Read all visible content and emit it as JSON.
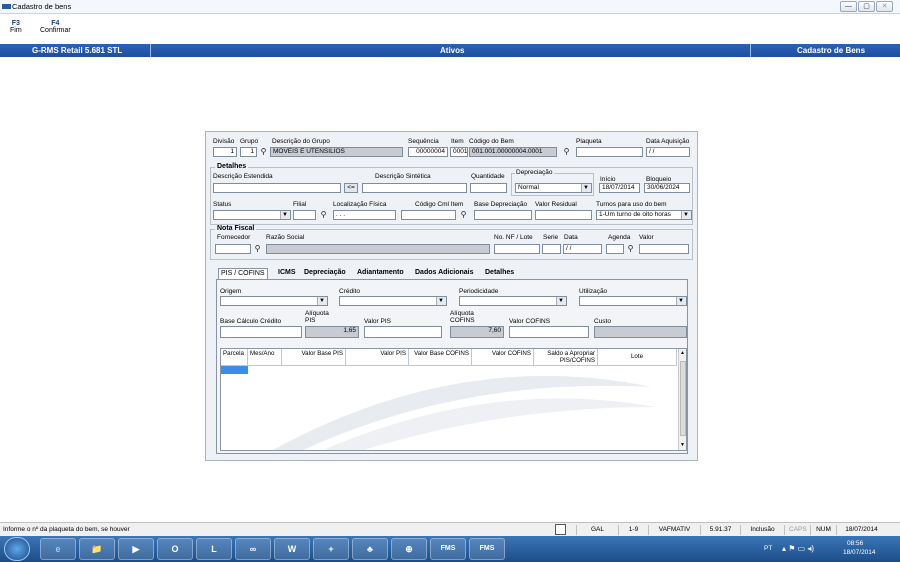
{
  "window": {
    "title": "Cadastro de bens"
  },
  "fkeys": [
    {
      "key": "F3",
      "label": "Fim"
    },
    {
      "key": "F4",
      "label": "Confirmar"
    }
  ],
  "header": {
    "left": "G-RMS Retail 5.681 STL",
    "center": "Ativos",
    "right": "Cadastro de Bens"
  },
  "form": {
    "divisao": {
      "label": "Divisão",
      "value": "1"
    },
    "grupo": {
      "label": "Grupo",
      "value": "1"
    },
    "desc_grupo": {
      "label": "Descrição do Grupo",
      "value": "MOVEIS E UTENSILIOS"
    },
    "sequencia": {
      "label": "Sequência",
      "value": "00000004"
    },
    "item": {
      "label": "Item",
      "value": "0001"
    },
    "codigo_bem": {
      "label": "Código do Bem",
      "value": "001.001.00000004.0001"
    },
    "plaqueta": {
      "label": "Plaqueta",
      "value": ""
    },
    "data_aquisicao": {
      "label": "Data Aquisição",
      "value": "/ /"
    },
    "detalhes_title": "Detalhes",
    "desc_estendida": {
      "label": "Descrição Estendida",
      "value": ""
    },
    "copy_btn": "<=",
    "desc_sintetica": {
      "label": "Descrição Sintética",
      "value": ""
    },
    "quantidade": {
      "label": "Quantidade",
      "value": ""
    },
    "depreciacao_group": "Depreciação",
    "depreciacao_sel": "Normal",
    "inicio": {
      "label": "Início",
      "value": "18/07/2014"
    },
    "bloqueio": {
      "label": "Bloqueio",
      "value": "30/06/2024"
    },
    "status": {
      "label": "Status",
      "value": ""
    },
    "filial": {
      "label": "Filial",
      "value": ""
    },
    "localizacao": {
      "label": "Localização Física",
      "value": ". . ."
    },
    "codigo_cml": {
      "label": "Código Cml Item",
      "value": ""
    },
    "base_dep": {
      "label": "Base Depreciação",
      "value": ""
    },
    "valor_residual": {
      "label": "Valor Residual",
      "value": ""
    },
    "turnos": {
      "label": "Turnos para uso do bem",
      "value": "1-Um turno de oito horas"
    },
    "nf_title": "Nota Fiscal",
    "fornecedor": {
      "label": "Fornecedor",
      "value": ""
    },
    "razao_social": {
      "label": "Razão Social",
      "value": ""
    },
    "nf_lote": {
      "label": "No. NF / Lote",
      "value": ""
    },
    "serie": {
      "label": "Serie",
      "value": ""
    },
    "data": {
      "label": "Data",
      "value": "/ /"
    },
    "agenda": {
      "label": "Agenda",
      "value": ""
    },
    "valor": {
      "label": "Valor",
      "value": ""
    }
  },
  "tabs": [
    "PIS / COFINS",
    "ICMS",
    "Depreciação",
    "Adiantamento",
    "Dados Adicionais",
    "Detalhes"
  ],
  "pis": {
    "origem": "Origem",
    "credito": "Crédito",
    "periodicidade": "Periodicidade",
    "utilizacao": "Utilização",
    "base_calc": "Base Cálculo Crédito",
    "aliq_pis": "Alíquota PIS",
    "aliq_pis_val": "1,65",
    "valor_pis": "Valor PIS",
    "aliq_cofins": "Alíquota COFINS",
    "aliq_cofins_val": "7,60",
    "valor_cofins": "Valor COFINS",
    "custo": "Custo"
  },
  "grid_headers": [
    "Parcela",
    "Mes/Ano",
    "Valor Base PIS",
    "Valor PIS",
    "Valor Base COFINS",
    "Valor COFINS",
    "Saldo a Apropriar PIS/COFINS",
    "Lote"
  ],
  "statusbar": {
    "message": "Informe o nº da plaqueta do bem, se houver",
    "items": [
      "GAL",
      "1-9",
      "VAFMATIV",
      "5.91.37",
      "Inclusão",
      "CAPS",
      "NUM",
      "18/07/2014"
    ]
  },
  "taskbar": {
    "lang": "PT",
    "time": "08:56",
    "date": "18/07/2014",
    "apps": [
      "e",
      "📁",
      "▶",
      "O",
      "L",
      "∞",
      "W",
      "+",
      "♣",
      "⊕",
      "FMS",
      "FMS"
    ]
  },
  "colors": {
    "header": "#1e4f9e",
    "taskbar": "#1d4d88"
  }
}
